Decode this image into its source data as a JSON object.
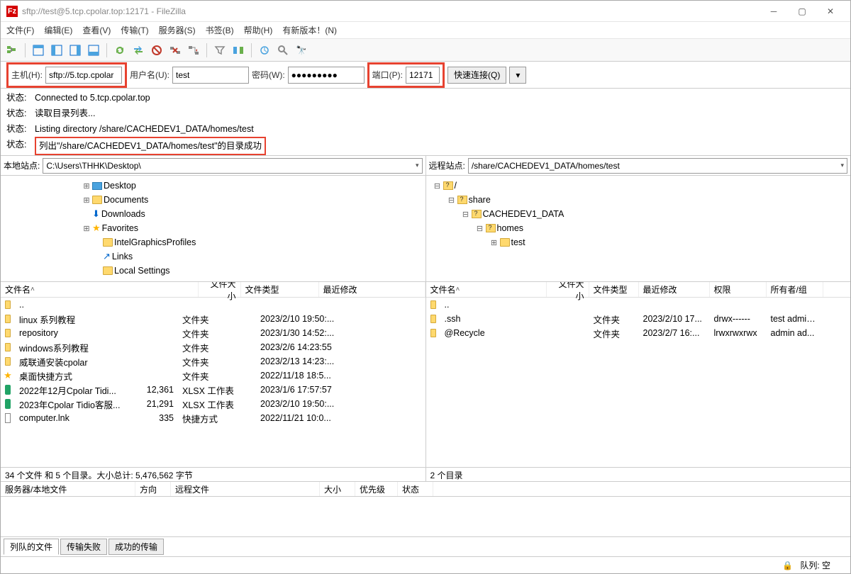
{
  "title": "sftp://test@5.tcp.cpolar.top:12171 - FileZilla",
  "menu": [
    "文件(F)",
    "编辑(E)",
    "查看(V)",
    "传输(T)",
    "服务器(S)",
    "书签(B)",
    "帮助(H)",
    "有新版本！(N)"
  ],
  "qc": {
    "host_lbl": "主机(H):",
    "host_val": "sftp://5.tcp.cpolar",
    "user_lbl": "用户名(U):",
    "user_val": "test",
    "pass_lbl": "密码(W):",
    "pass_val": "●●●●●●●●●",
    "port_lbl": "端口(P):",
    "port_val": "12171",
    "connect": "快速连接(Q)"
  },
  "log_label": "状态:",
  "logs": [
    "Connected to 5.tcp.cpolar.top",
    "读取目录列表...",
    "Listing directory /share/CACHEDEV1_DATA/homes/test",
    "列出\"/share/CACHEDEV1_DATA/homes/test\"的目录成功"
  ],
  "local_path_lbl": "本地站点:",
  "local_path": "C:\\Users\\THHK\\Desktop\\",
  "remote_path_lbl": "远程站点:",
  "remote_path": "/share/CACHEDEV1_DATA/homes/test",
  "local_tree": [
    {
      "indent": 115,
      "exp": "⊞",
      "icon": "desktop",
      "label": "Desktop"
    },
    {
      "indent": 115,
      "exp": "⊞",
      "icon": "folder",
      "label": "Documents"
    },
    {
      "indent": 115,
      "exp": "",
      "icon": "down",
      "label": "Downloads"
    },
    {
      "indent": 115,
      "exp": "⊞",
      "icon": "star",
      "label": "Favorites"
    },
    {
      "indent": 130,
      "exp": "",
      "icon": "folder",
      "label": "IntelGraphicsProfiles"
    },
    {
      "indent": 130,
      "exp": "",
      "icon": "link",
      "label": "Links"
    },
    {
      "indent": 130,
      "exp": "",
      "icon": "folder",
      "label": "Local Settings"
    }
  ],
  "remote_tree": [
    {
      "indent": 10,
      "exp": "⊟",
      "icon": "folderq",
      "label": "/"
    },
    {
      "indent": 30,
      "exp": "⊟",
      "icon": "folderq",
      "label": "share"
    },
    {
      "indent": 50,
      "exp": "⊟",
      "icon": "folderq",
      "label": "CACHEDEV1_DATA"
    },
    {
      "indent": 70,
      "exp": "⊟",
      "icon": "folderq",
      "label": "homes"
    },
    {
      "indent": 90,
      "exp": "⊞",
      "icon": "folder",
      "label": "test"
    }
  ],
  "local_cols": [
    "文件名",
    "文件大小",
    "文件类型",
    "最近修改"
  ],
  "local_files": [
    {
      "icon": "folder",
      "name": "..",
      "size": "",
      "type": "",
      "date": ""
    },
    {
      "icon": "folder",
      "name": "linux 系列教程",
      "size": "",
      "type": "文件夹",
      "date": "2023/2/10 19:50:..."
    },
    {
      "icon": "folder",
      "name": "repository",
      "size": "",
      "type": "文件夹",
      "date": "2023/1/30 14:52:..."
    },
    {
      "icon": "folder",
      "name": "windows系列教程",
      "size": "",
      "type": "文件夹",
      "date": "2023/2/6 14:23:55"
    },
    {
      "icon": "folder",
      "name": "威联通安装cpolar",
      "size": "",
      "type": "文件夹",
      "date": "2023/2/13 14:23:..."
    },
    {
      "icon": "star",
      "name": "桌面快捷方式",
      "size": "",
      "type": "文件夹",
      "date": "2022/11/18 18:5..."
    },
    {
      "icon": "xlsx",
      "name": "2022年12月Cpolar Tidi...",
      "size": "12,361",
      "type": "XLSX 工作表",
      "date": "2023/1/6 17:57:57"
    },
    {
      "icon": "xlsx",
      "name": "2023年Cpolar Tidio客服...",
      "size": "21,291",
      "type": "XLSX 工作表",
      "date": "2023/2/10 19:50:..."
    },
    {
      "icon": "doc",
      "name": "computer.lnk",
      "size": "335",
      "type": "快捷方式",
      "date": "2022/11/21 10:0..."
    }
  ],
  "local_status": "34 个文件 和 5 个目录。大小总计: 5,476,562 字节",
  "remote_cols": [
    "文件名",
    "文件大小",
    "文件类型",
    "最近修改",
    "权限",
    "所有者/组"
  ],
  "remote_files": [
    {
      "icon": "folder",
      "name": "..",
      "size": "",
      "type": "",
      "date": "",
      "perm": "",
      "owner": ""
    },
    {
      "icon": "folder",
      "name": ".ssh",
      "size": "",
      "type": "文件夹",
      "date": "2023/2/10 17...",
      "perm": "drwx------",
      "owner": "test admini..."
    },
    {
      "icon": "folder",
      "name": "@Recycle",
      "size": "",
      "type": "文件夹",
      "date": "2023/2/7 16:...",
      "perm": "lrwxrwxrwx",
      "owner": "admin ad..."
    }
  ],
  "remote_status": "2 个目录",
  "queue_cols": [
    "服务器/本地文件",
    "方向",
    "远程文件",
    "大小",
    "优先级",
    "状态"
  ],
  "queue_widths": [
    190,
    50,
    210,
    50,
    60,
    50
  ],
  "tabs": [
    "列队的文件",
    "传输失败",
    "成功的传输"
  ],
  "footer_lock": "🔒",
  "footer_queue": "队列: 空"
}
